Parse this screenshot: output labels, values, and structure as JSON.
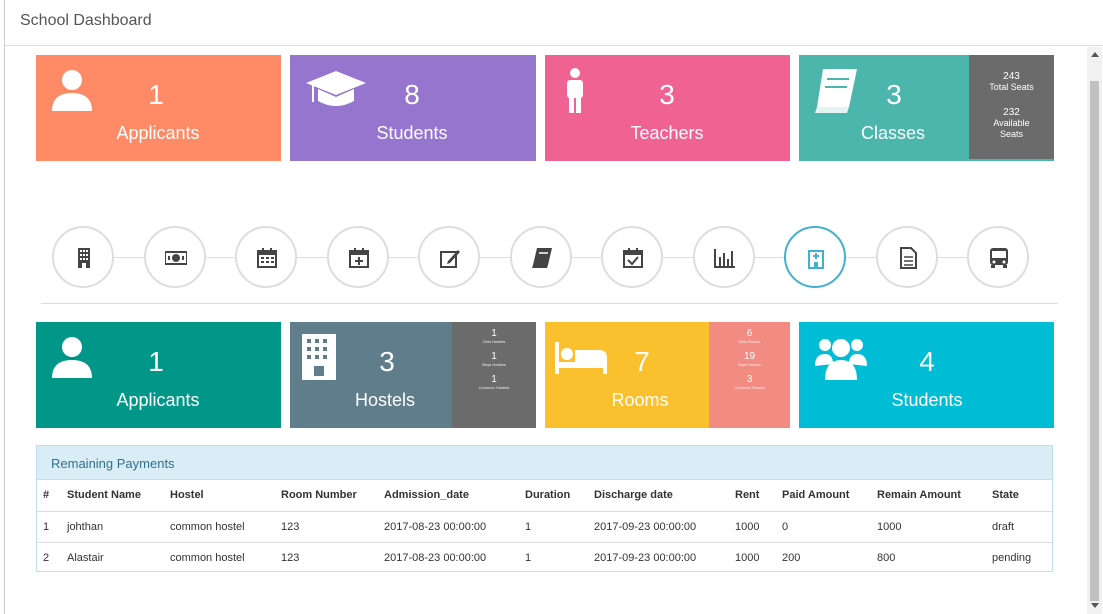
{
  "window": {
    "title": "School Dashboard"
  },
  "top_cards": [
    {
      "value": "1",
      "label": "Applicants",
      "icon": "user-icon",
      "color": "#ff8a65"
    },
    {
      "value": "8",
      "label": "Students",
      "icon": "graduation-cap-icon",
      "color": "#9575cd"
    },
    {
      "value": "3",
      "label": "Teachers",
      "icon": "person-icon",
      "color": "#f06292"
    },
    {
      "value": "3",
      "label": "Classes",
      "icon": "book-icon",
      "color": "#4db6ac"
    }
  ],
  "classes_side": {
    "total_value": "243",
    "total_label": "Total Seats",
    "available_value": "232",
    "available_label_1": "Available",
    "available_label_2": "Seats"
  },
  "nav_icons": [
    "building-icon",
    "money-icon",
    "calendar-icon",
    "calendar-plus-icon",
    "edit-icon",
    "book-icon",
    "calendar-check-icon",
    "bar-chart-icon",
    "hospital-icon",
    "document-icon",
    "bus-icon"
  ],
  "bottom_cards": [
    {
      "value": "1",
      "label": "Applicants",
      "icon": "user-icon",
      "color": "#009688"
    },
    {
      "value": "3",
      "label": "Hostels",
      "icon": "building-icon",
      "color": "#607d8b"
    },
    {
      "value": "7",
      "label": "Rooms",
      "icon": "bed-icon",
      "color": "#fbc02d"
    },
    {
      "value": "4",
      "label": "Students",
      "icon": "users-icon",
      "color": "#00bcd4"
    }
  ],
  "hostels_side": [
    {
      "value": "1",
      "label": "Girls Hostels"
    },
    {
      "value": "1",
      "label": "Boys Hostels"
    },
    {
      "value": "1",
      "label": "Common Hostels"
    }
  ],
  "rooms_side": [
    {
      "value": "6",
      "label": "Girls Rooms"
    },
    {
      "value": "19",
      "label": "Boys Rooms"
    },
    {
      "value": "3",
      "label": "Common Rooms"
    }
  ],
  "payments": {
    "title": "Remaining Payments",
    "columns": [
      "#",
      "Student Name",
      "Hostel",
      "Room Number",
      "Admission_date",
      "Duration",
      "Discharge date",
      "Rent",
      "Paid Amount",
      "Remain Amount",
      "State"
    ],
    "rows": [
      [
        "1",
        "johthan",
        "common hostel",
        "123",
        "2017-08-23 00:00:00",
        "1",
        "2017-09-23 00:00:00",
        "1000",
        "0",
        "1000",
        "draft"
      ],
      [
        "2",
        "Alastair",
        "common hostel",
        "123",
        "2017-08-23 00:00:00",
        "1",
        "2017-09-23 00:00:00",
        "1000",
        "200",
        "800",
        "pending"
      ]
    ]
  }
}
